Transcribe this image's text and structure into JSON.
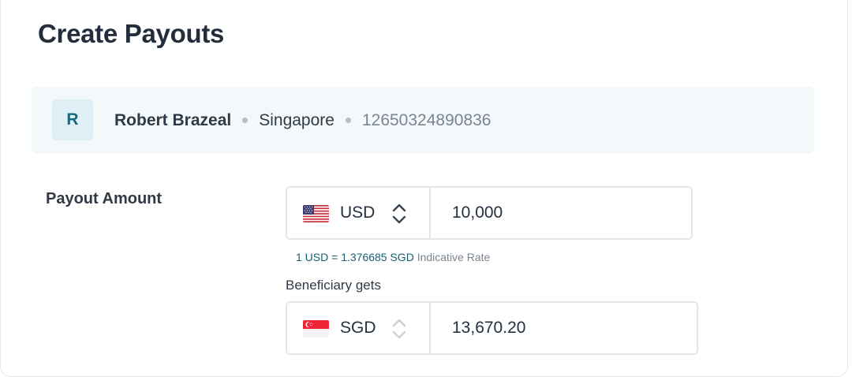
{
  "page": {
    "title": "Create Payouts"
  },
  "beneficiary": {
    "initial": "R",
    "name": "Robert Brazeal",
    "country": "Singapore",
    "account_number": "12650324890836"
  },
  "payout": {
    "label": "Payout Amount",
    "send": {
      "currency": "USD",
      "flag_icon": "us-flag-icon",
      "amount": "10,000"
    },
    "rate": {
      "value": "1 USD = 1.376685 SGD",
      "note": "Indicative Rate"
    },
    "receive": {
      "label": "Beneficiary gets",
      "currency": "SGD",
      "flag_icon": "sg-flag-icon",
      "amount": "13,670.20"
    }
  },
  "colors": {
    "accent": "#1a6880",
    "rate_text": "#1a5e73",
    "border": "#e3e7ec",
    "beneficiary_bg": "#f3f8fb"
  }
}
